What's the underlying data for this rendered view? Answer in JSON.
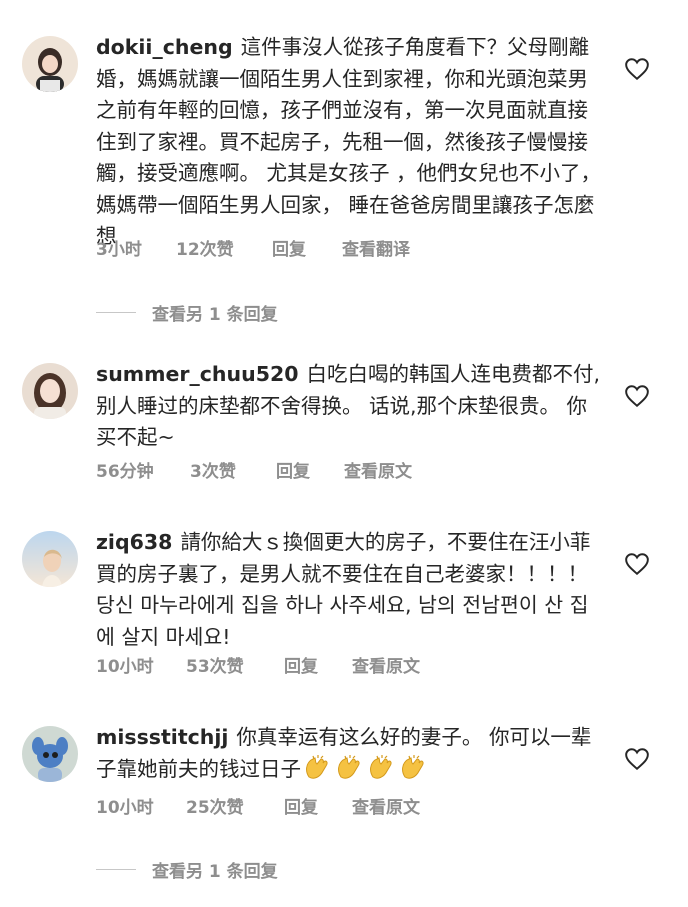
{
  "comments": [
    {
      "username": "dokii_cheng",
      "text": "這件事沒人從孩子角度看下？父母剛離婚，媽媽就讓一個陌生男人住到家裡，你和光頭泡菜男之前有年輕的回憶，孩子們並沒有，第一次見面就直接住到了家裡。買不起房子，先租一個，然後孩子慢慢接觸，接受適應啊。 尤其是女孩子 ，他們女兒也不小了，媽媽帶一個陌生男人回家， 睡在爸爸房間里讓孩子怎麼想",
      "time": "3小时",
      "likes": "12次赞",
      "reply": "回复",
      "translate": "查看翻译",
      "view_replies": "查看另 1 条回复"
    },
    {
      "username": "summer_chuu520",
      "text": "白吃白喝的韩国人连电费都不付,别人睡过的床垫都不舍得换。 话说,那个床垫很贵。 你买不起~",
      "time": "56分钟",
      "likes": "3次赞",
      "reply": "回复",
      "translate": "查看原文"
    },
    {
      "username": "ziq638",
      "text": "請你給大ｓ換個更大的房子，不要住在汪小菲買的房子裏了，是男人就不要住在自己老婆家！！！！당신 마누라에게 집을 하나 사주세요, 남의 전남편이 산 집에 살지 마세요!",
      "time": "10小时",
      "likes": "53次赞",
      "reply": "回复",
      "translate": "查看原文"
    },
    {
      "username": "missstitchjj",
      "text": "你真幸运有这么好的妻子。 你可以一辈子靠她前夫的钱过日子",
      "emoji": "👏👏👏👏",
      "time": "10小时",
      "likes": "25次赞",
      "reply": "回复",
      "translate": "查看原文",
      "view_replies": "查看另 1 条回复"
    }
  ],
  "icons": {
    "like": "heart-outline-icon",
    "emoji": "clapping-hands-icon"
  },
  "colors": {
    "text": "#262626",
    "meta": "#8e8e8e",
    "clap": "#f5c242"
  }
}
